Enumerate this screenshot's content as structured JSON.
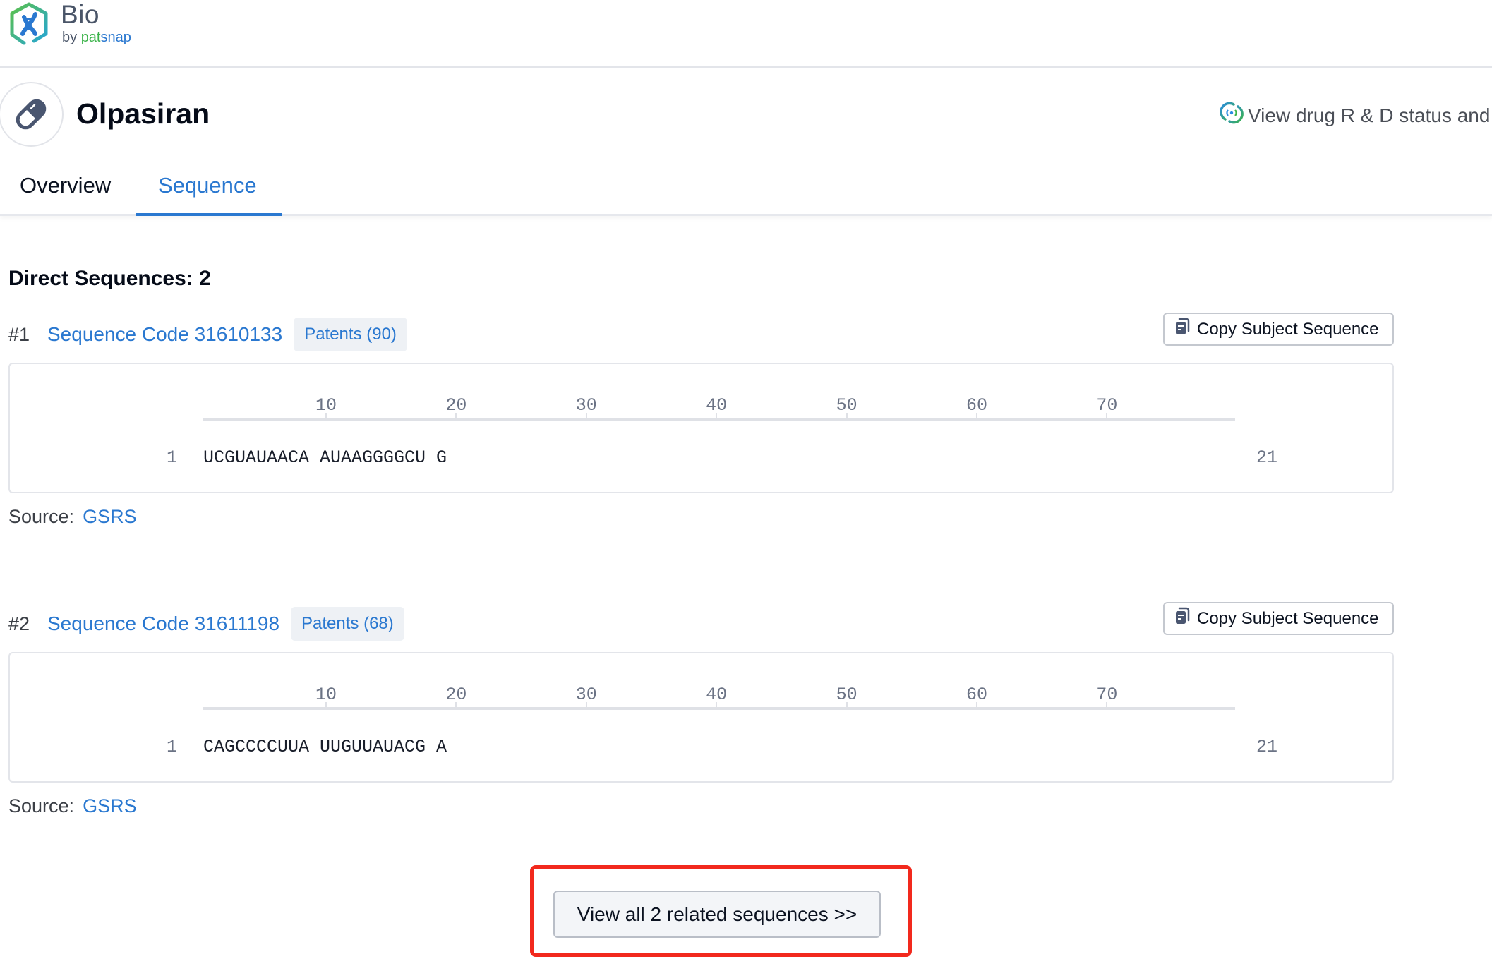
{
  "app": {
    "logo_title": "Bio",
    "logo_by": "by ",
    "logo_pat": "pat",
    "logo_snap": "snap",
    "logo_icon": "dna-hexagon-icon",
    "brand_colors": {
      "blue": "#2a78d0",
      "green": "#3bb34a",
      "highlight_red": "#f2291d"
    }
  },
  "drug": {
    "name": "Olpasiran",
    "icon": "pill-icon",
    "rd_link_label": "View drug R & D status and",
    "rd_link_icon": "sync-circle-icon"
  },
  "tabs": [
    {
      "label": "Overview",
      "active": false
    },
    {
      "label": "Sequence",
      "active": true
    }
  ],
  "section": {
    "title": "Direct Sequences: 2"
  },
  "ruler": {
    "ticks": [
      "10",
      "20",
      "30",
      "40",
      "50",
      "60",
      "70"
    ]
  },
  "sequences": [
    {
      "index": "#1",
      "code_label": "Sequence Code 31610133",
      "patents_label": "Patents (90)",
      "copy_label": "Copy Subject Sequence",
      "line_start": "1",
      "sequence_text": "UCGUAUAACA AUAAGGGGCU G",
      "line_end": "21",
      "source_label": "Source:",
      "source_value": "GSRS"
    },
    {
      "index": "#2",
      "code_label": "Sequence Code 31611198",
      "patents_label": "Patents (68)",
      "copy_label": "Copy Subject Sequence",
      "line_start": "1",
      "sequence_text": "CAGCCCCUUA UUGUUAUACG A",
      "line_end": "21",
      "source_label": "Source:",
      "source_value": "GSRS"
    }
  ],
  "footer": {
    "view_all_label": "View all 2 related sequences >>"
  }
}
